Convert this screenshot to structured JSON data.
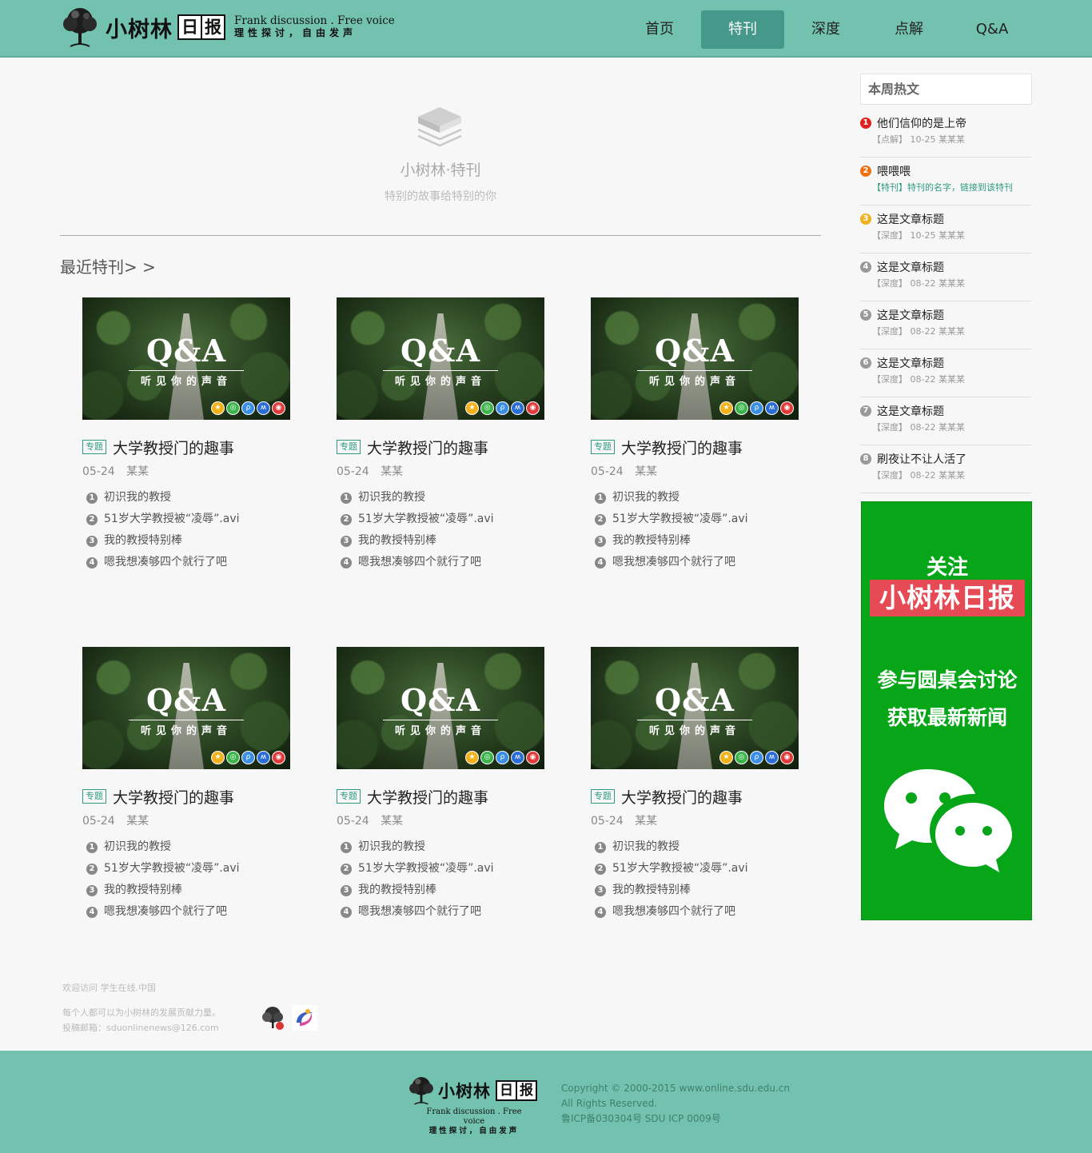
{
  "header": {
    "logo_name": "小树林",
    "logo_box": [
      "日",
      "报"
    ],
    "slogan_en": "Frank discussion . Free voice",
    "slogan_cn": "理性探讨，自由发声",
    "nav": [
      {
        "label": "首页",
        "active": false
      },
      {
        "label": "特刊",
        "active": true
      },
      {
        "label": "深度",
        "active": false
      },
      {
        "label": "点解",
        "active": false
      },
      {
        "label": "Q&A",
        "active": false
      }
    ]
  },
  "intro": {
    "title": "小树林·特刊",
    "subtitle": "特别的故事给特别的你"
  },
  "recent_title": "最近特刊> >",
  "cards": [
    {
      "thumb_title": "Q&A",
      "thumb_sub": "听见你的声音",
      "tag": "专题",
      "title": "大学教授门的趣事",
      "date": "05-24",
      "author": "某某",
      "items": [
        "初识我的教授",
        "51岁大学教授被“凌辱”.avi",
        "我的教授特别棒",
        "嗯我想凑够四个就行了吧"
      ]
    },
    {
      "thumb_title": "Q&A",
      "thumb_sub": "听见你的声音",
      "tag": "专题",
      "title": "大学教授门的趣事",
      "date": "05-24",
      "author": "某某",
      "items": [
        "初识我的教授",
        "51岁大学教授被“凌辱”.avi",
        "我的教授特别棒",
        "嗯我想凑够四个就行了吧"
      ]
    },
    {
      "thumb_title": "Q&A",
      "thumb_sub": "听见你的声音",
      "tag": "专题",
      "title": "大学教授门的趣事",
      "date": "05-24",
      "author": "某某",
      "items": [
        "初识我的教授",
        "51岁大学教授被“凌辱”.avi",
        "我的教授特别棒",
        "嗯我想凑够四个就行了吧"
      ]
    },
    {
      "thumb_title": "Q&A",
      "thumb_sub": "听见你的声音",
      "tag": "专题",
      "title": "大学教授门的趣事",
      "date": "05-24",
      "author": "某某",
      "items": [
        "初识我的教授",
        "51岁大学教授被“凌辱”.avi",
        "我的教授特别棒",
        "嗯我想凑够四个就行了吧"
      ]
    },
    {
      "thumb_title": "Q&A",
      "thumb_sub": "听见你的声音",
      "tag": "专题",
      "title": "大学教授门的趣事",
      "date": "05-24",
      "author": "某某",
      "items": [
        "初识我的教授",
        "51岁大学教授被“凌辱”.avi",
        "我的教授特别棒",
        "嗯我想凑够四个就行了吧"
      ]
    },
    {
      "thumb_title": "Q&A",
      "thumb_sub": "听见你的声音",
      "tag": "专题",
      "title": "大学教授门的趣事",
      "date": "05-24",
      "author": "某某",
      "items": [
        "初识我的教授",
        "51岁大学教授被“凌辱”.avi",
        "我的教授特别棒",
        "嗯我想凑够四个就行了吧"
      ]
    }
  ],
  "sidebar": {
    "hot_title": "本周热文",
    "hot": [
      {
        "num": "1",
        "color": "#e02020",
        "title": "他们信仰的是上帝",
        "meta": "【点解】 10-25 某某某",
        "special": false
      },
      {
        "num": "2",
        "color": "#f07010",
        "title": "喂喂喂",
        "meta": "【特刊】特刊的名字，链接到该特刊",
        "special": true
      },
      {
        "num": "3",
        "color": "#f0b020",
        "title": "这是文章标题",
        "meta": "【深度】 10-25 某某某",
        "special": false
      },
      {
        "num": "4",
        "color": "#999999",
        "title": "这是文章标题",
        "meta": "【深度】 08-22 某某某",
        "special": false
      },
      {
        "num": "5",
        "color": "#999999",
        "title": "这是文章标题",
        "meta": "【深度】 08-22 某某某",
        "special": false
      },
      {
        "num": "6",
        "color": "#999999",
        "title": "这是文章标题",
        "meta": "【深度】 08-22 某某某",
        "special": false
      },
      {
        "num": "7",
        "color": "#999999",
        "title": "这是文章标题",
        "meta": "【深度】 08-22 某某某",
        "special": false
      },
      {
        "num": "8",
        "color": "#999999",
        "title": "刷夜让不让人活了",
        "meta": "【深度】 08-22 某某某",
        "special": false
      }
    ],
    "promo": {
      "line1": "关注",
      "brand": "小树林日报",
      "line2": "参与圆桌会讨论",
      "line3": "获取最新新闻",
      "icon": "wechat-icon"
    }
  },
  "footer_info": {
    "welcome": "欢迎访问 学生在线.中国",
    "line1": "每个人都可以为小树林的发展贡献力量。",
    "line2": "投稿邮箱：sduonlinenews@126.com"
  },
  "footer": {
    "logo_name": "小树林",
    "logo_box": [
      "日",
      "报"
    ],
    "slogan_en": "Frank discussion . Free voice",
    "slogan_cn": "理性探讨，自由发声",
    "copyright": [
      "Copyright © 2000-2015 www.online.sdu.edu.cn",
      "All Rights Reserved.",
      "鲁ICP备030304号 SDU ICP 0009号"
    ]
  },
  "colors": {
    "header_bg": "#73c2af",
    "nav_active": "#45998a",
    "promo_bg": "#07a619",
    "brand_red": "#e54a55"
  }
}
